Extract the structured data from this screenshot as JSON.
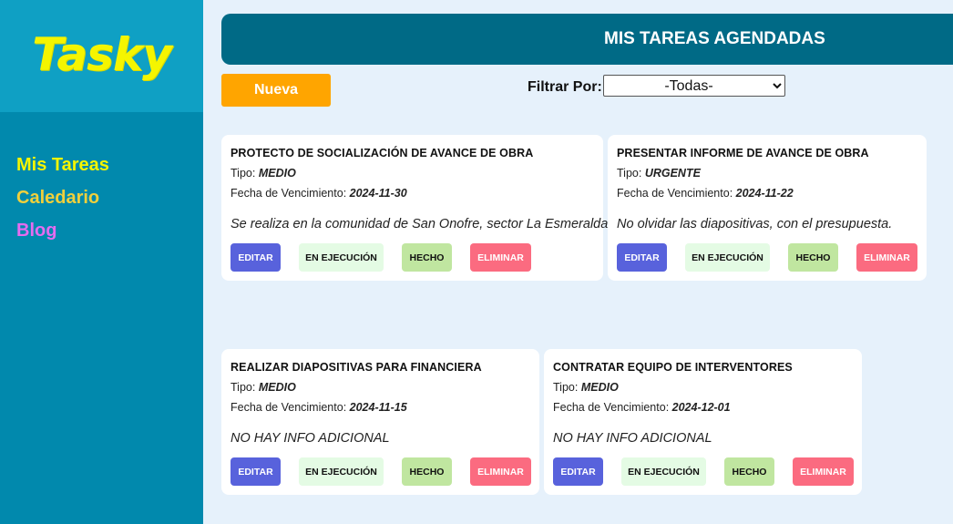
{
  "app": {
    "logo": "Tasky"
  },
  "nav": {
    "items": [
      {
        "label": "Mis Tareas",
        "color": "#f5f500"
      },
      {
        "label": "Caledario",
        "color": "#f0d03c"
      },
      {
        "label": "Blog",
        "color": "#e56cf0"
      }
    ]
  },
  "header": {
    "title": "MIS TAREAS AGENDADAS"
  },
  "toolbar": {
    "new_label": "Nueva",
    "filter_label": "Filtrar Por:",
    "filter_value": "-Todas-"
  },
  "card_labels": {
    "type_prefix": "Tipo: ",
    "due_prefix": "Fecha de Vencimiento: ",
    "edit": "EDITAR",
    "running": "EN EJECUCIÓN",
    "done": "HECHO",
    "delete": "ELIMINAR"
  },
  "tasks": [
    {
      "title": "PROTECTO DE SOCIALIZACIÓN DE AVANCE DE OBRA",
      "type": "MEDIO",
      "due": "2024-11-30",
      "description": "Se realiza en la comunidad de San Onofre, sector La Esmeralda"
    },
    {
      "title": "PRESENTAR INFORME DE AVANCE DE OBRA",
      "type": "URGENTE",
      "due": "2024-11-22",
      "description": "No olvidar las diapositivas, con el presupuesta."
    },
    {
      "title": "REALIZAR DIAPOSITIVAS PARA FINANCIERA",
      "type": "MEDIO",
      "due": "2024-11-15",
      "description": "NO HAY INFO ADICIONAL"
    },
    {
      "title": "CONTRATAR EQUIPO DE INTERVENTORES",
      "type": "MEDIO",
      "due": "2024-12-01",
      "description": "NO HAY INFO ADICIONAL"
    }
  ]
}
